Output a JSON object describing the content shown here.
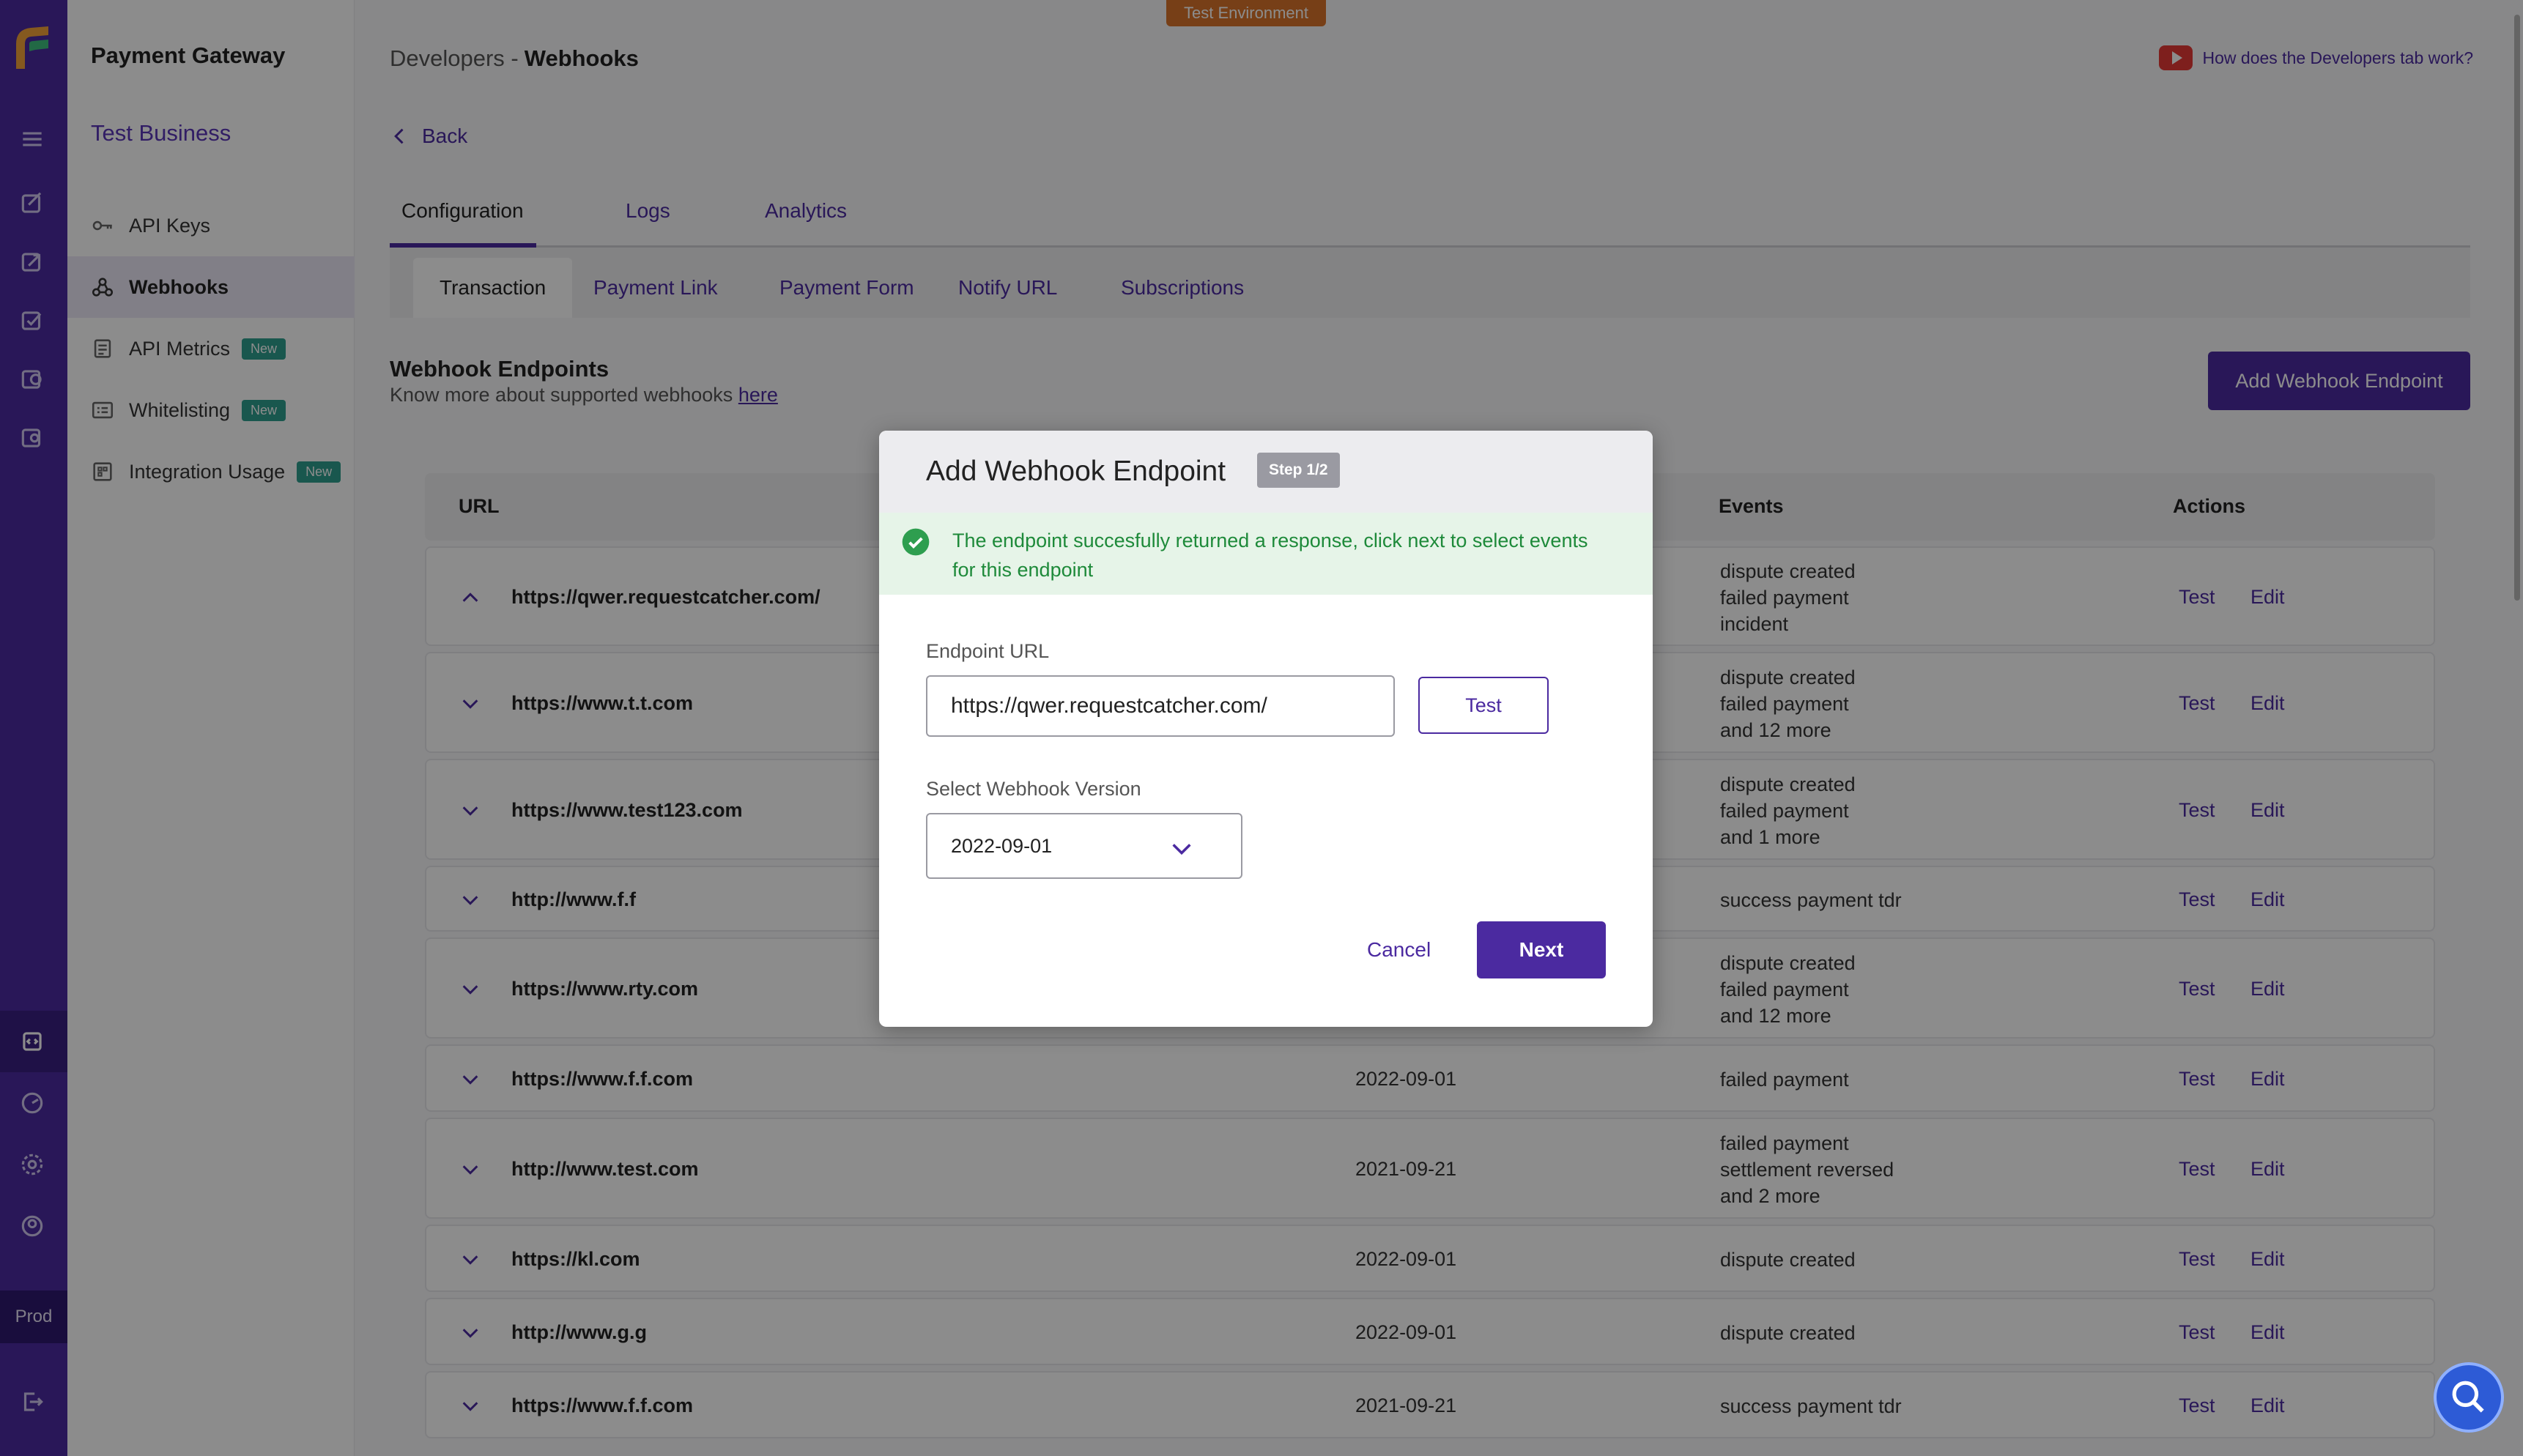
{
  "environment_tag": "Test Environment",
  "sidebar": {
    "app_title": "Payment Gateway",
    "business_name": "Test Business",
    "items": [
      {
        "label": "API Keys",
        "icon": "key-icon",
        "badge": ""
      },
      {
        "label": "Webhooks",
        "icon": "webhook-icon",
        "badge": ""
      },
      {
        "label": "API Metrics",
        "icon": "metrics-icon",
        "badge": "New"
      },
      {
        "label": "Whitelisting",
        "icon": "list-icon",
        "badge": "New"
      },
      {
        "label": "Integration Usage",
        "icon": "grid-icon",
        "badge": "New"
      }
    ]
  },
  "rail": {
    "env_label": "Prod"
  },
  "header": {
    "breadcrumb_parent": "Developers -",
    "breadcrumb_current": "Webhooks",
    "help_link": "How does the Developers tab work?",
    "back_label": "Back"
  },
  "tabs_primary": [
    "Configuration",
    "Logs",
    "Analytics"
  ],
  "tabs_secondary": [
    "Transaction",
    "Payment Link",
    "Payment Form",
    "Notify URL",
    "Subscriptions"
  ],
  "endpoints_section": {
    "title": "Webhook Endpoints",
    "subtitle": "Know more about supported webhooks",
    "link_text": "here",
    "add_button": "Add Webhook Endpoint"
  },
  "table": {
    "columns": [
      "URL",
      "Events",
      "Actions"
    ],
    "action_test": "Test",
    "action_edit": "Edit",
    "rows": [
      {
        "url": "https://qwer.requestcatcher.com/",
        "version": "",
        "events": [
          "dispute created",
          "failed payment",
          "incident"
        ],
        "expanded": true
      },
      {
        "url": "https://www.t.t.com",
        "version": "",
        "events": [
          "dispute created",
          "failed payment",
          "and 12 more"
        ],
        "expanded": false
      },
      {
        "url": "https://www.test123.com",
        "version": "",
        "events": [
          "dispute created",
          "failed payment",
          "and 1 more"
        ],
        "expanded": false
      },
      {
        "url": "http://www.f.f",
        "version": "",
        "events": [
          "success payment tdr"
        ],
        "expanded": false
      },
      {
        "url": "https://www.rty.com",
        "version": "",
        "events": [
          "dispute created",
          "failed payment",
          "and 12 more"
        ],
        "expanded": false
      },
      {
        "url": "https://www.f.f.com",
        "version": "2022-09-01",
        "events": [
          "failed payment"
        ],
        "expanded": false
      },
      {
        "url": "http://www.test.com",
        "version": "2021-09-21",
        "events": [
          "failed payment",
          "settlement reversed",
          "and 2 more"
        ],
        "expanded": false
      },
      {
        "url": "https://kl.com",
        "version": "2022-09-01",
        "events": [
          "dispute created"
        ],
        "expanded": false
      },
      {
        "url": "http://www.g.g",
        "version": "2022-09-01",
        "events": [
          "dispute created"
        ],
        "expanded": false
      },
      {
        "url": "https://www.f.f.com",
        "version": "2021-09-21",
        "events": [
          "success payment tdr"
        ],
        "expanded": false
      }
    ]
  },
  "modal": {
    "title": "Add Webhook Endpoint",
    "step": "Step 1/2",
    "success_message": "The endpoint succesfully returned a response, click next to select events for this endpoint",
    "endpoint_label": "Endpoint URL",
    "endpoint_value": "https://qwer.requestcatcher.com/",
    "test_button": "Test",
    "version_label": "Select Webhook Version",
    "version_value": "2022-09-01",
    "cancel_button": "Cancel",
    "next_button": "Next"
  },
  "colors": {
    "brand": "#4b2aa0",
    "success": "#1e8a3a",
    "env_tag": "#d9742a"
  }
}
